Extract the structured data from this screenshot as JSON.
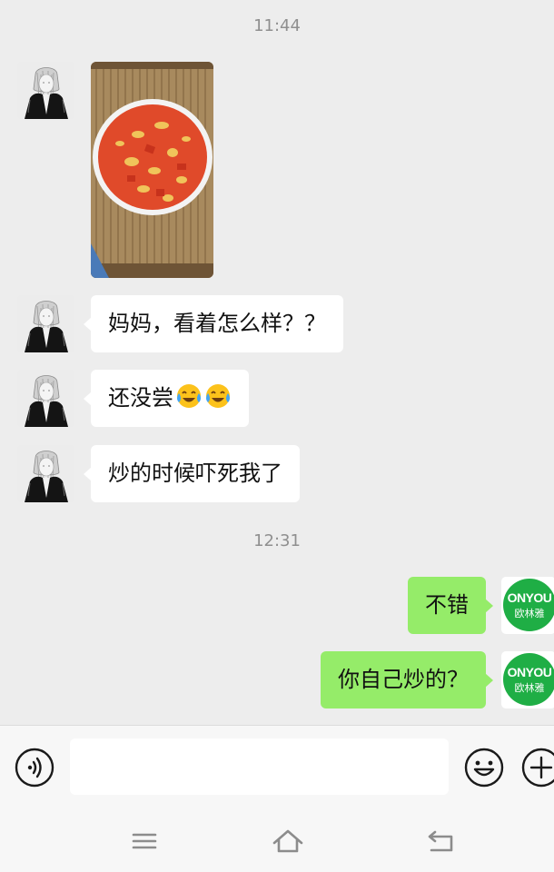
{
  "chat": {
    "time_1": "11:44",
    "time_2": "12:31",
    "messages": [
      {
        "sender": "contact",
        "type": "image",
        "image_desc": "tomato-egg-stir-fry-photo"
      },
      {
        "sender": "contact",
        "type": "text",
        "text": "妈妈，看着怎么样？？"
      },
      {
        "sender": "contact",
        "type": "text",
        "text": "还没尝",
        "emoji": [
          "tears-of-joy-emoji",
          "tears-of-joy-emoji"
        ]
      },
      {
        "sender": "contact",
        "type": "text",
        "text": "炒的时候吓死我了"
      },
      {
        "sender": "self",
        "type": "text",
        "text": "不错"
      },
      {
        "sender": "self",
        "type": "text",
        "text": "你自己炒的？"
      }
    ],
    "self_avatar": {
      "line1": "ONYOU",
      "line2": "欧林雅",
      "color": "#1fae45"
    }
  },
  "input_bar": {
    "placeholder": "",
    "icons": [
      "voice-icon",
      "emoji-icon",
      "plus-icon"
    ]
  },
  "nav_bar": {
    "icons": [
      "menu-icon",
      "home-icon",
      "back-icon"
    ]
  },
  "colors": {
    "background": "#ededed",
    "incoming_bubble": "#ffffff",
    "outgoing_bubble": "#95ec69"
  }
}
